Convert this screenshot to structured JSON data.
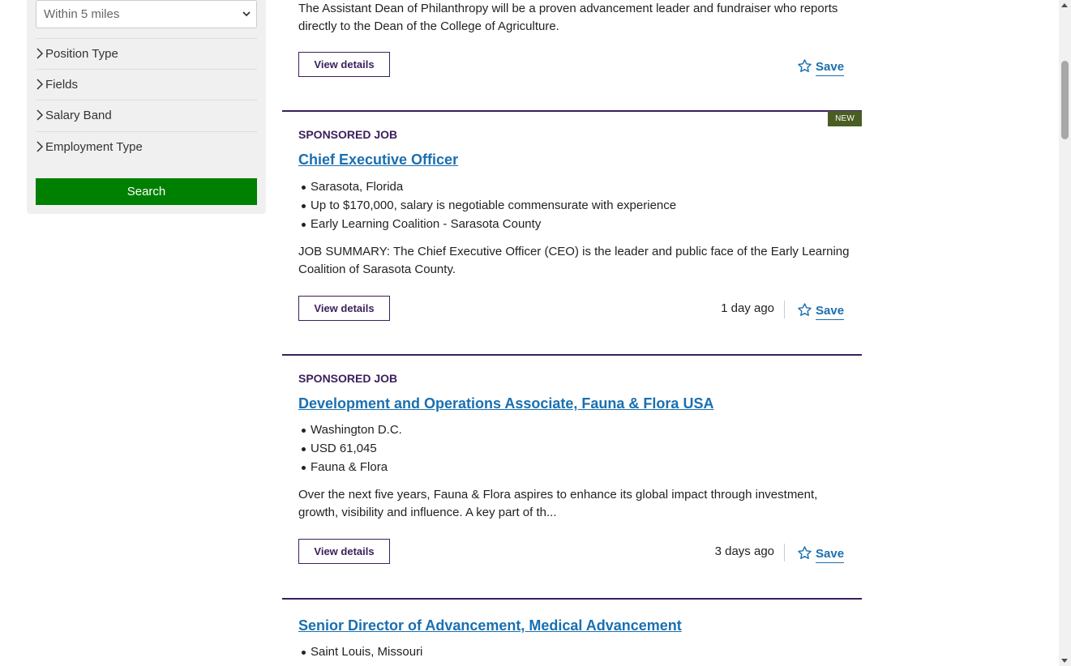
{
  "sidebar": {
    "distance_select": {
      "value": "Within 5 miles"
    },
    "filters": [
      {
        "label": "Position Type"
      },
      {
        "label": "Fields"
      },
      {
        "label": "Salary Band"
      },
      {
        "label": "Employment Type"
      }
    ],
    "search_label": "Search"
  },
  "jobs": [
    {
      "summary": "The Assistant Dean of Philanthropy will be a proven advancement leader and fundraiser who reports directly to the Dean of the College of Agriculture.",
      "view_label": "View details",
      "save_label": "Save"
    },
    {
      "badge": "NEW",
      "sponsored": "SPONSORED JOB",
      "title": "Chief Executive Officer",
      "location": "Sarasota, Florida",
      "salary": "Up to $170,000, salary is negotiable commensurate with experience",
      "employer": "Early Learning Coalition - Sarasota County",
      "summary": "JOB SUMMARY: The Chief Executive Officer (CEO) is the leader and public face of the Early Learning Coalition of Sarasota County.",
      "view_label": "View details",
      "posted": "1 day ago",
      "save_label": "Save"
    },
    {
      "sponsored": "SPONSORED JOB",
      "title": "Development and Operations Associate, Fauna & Flora USA",
      "location": "Washington D.C.",
      "salary": "USD 61,045",
      "employer": "Fauna & Flora",
      "summary": "Over the next five years, Fauna & Flora aspires to enhance its global impact through investment, growth, visibility and influence. A key part of th...",
      "view_label": "View details",
      "posted": "3 days ago",
      "save_label": "Save"
    },
    {
      "title": "Senior Director of Advancement, Medical Advancement",
      "location": "Saint Louis, Missouri"
    }
  ],
  "colors": {
    "accent_purple": "#3b1f5c",
    "link_blue": "#1a6fb0",
    "search_green": "#008000",
    "badge_green": "#4a5d23"
  },
  "icons": {
    "save": "star-outline-icon",
    "filter_toggle": "chevron-right-icon",
    "select_toggle": "chevron-down-icon"
  }
}
